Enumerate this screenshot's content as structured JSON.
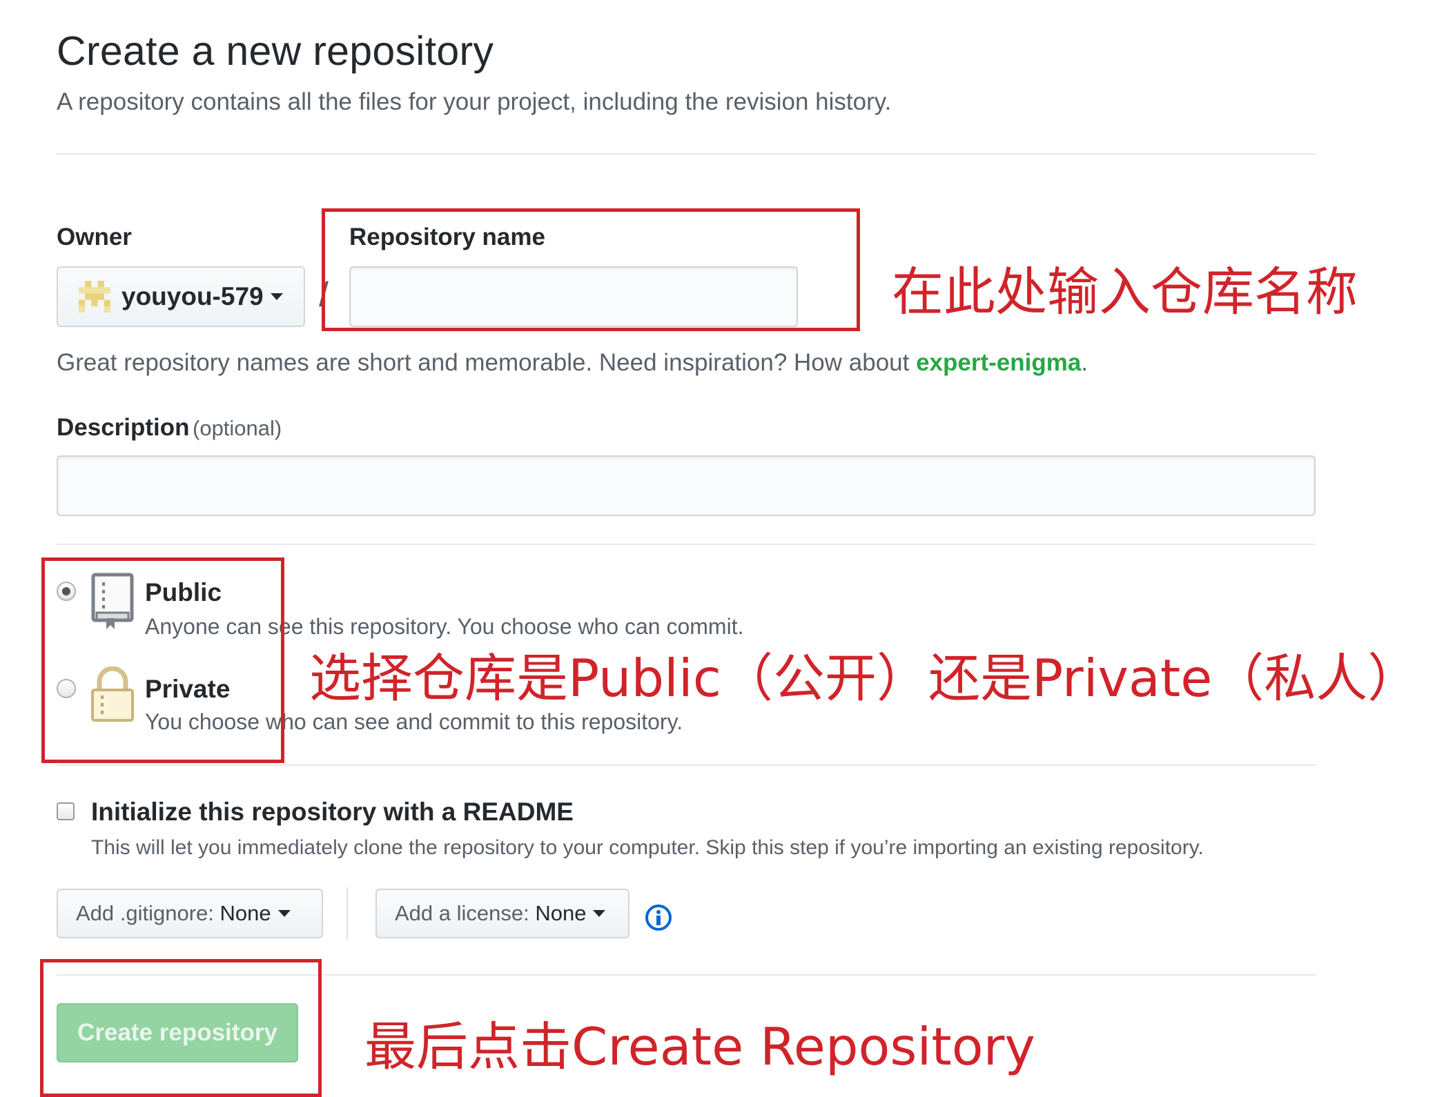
{
  "header": {
    "title": "Create a new repository",
    "subtitle": "A repository contains all the files for your project, including the revision history."
  },
  "owner": {
    "label": "Owner",
    "value": "youyou-579"
  },
  "slash": "/",
  "repo_name": {
    "label": "Repository name",
    "value": "",
    "placeholder": ""
  },
  "name_hint": {
    "text": "Great repository names are short and memorable. Need inspiration? How about ",
    "suggestion": "expert-enigma",
    "end": "."
  },
  "description": {
    "label": "Description",
    "optional": "(optional)",
    "value": ""
  },
  "visibility": {
    "selected": "public",
    "public": {
      "label": "Public",
      "note": "Anyone can see this repository. You choose who can commit."
    },
    "private": {
      "label": "Private",
      "note": "You choose who can see and commit to this repository."
    }
  },
  "readme": {
    "checked": false,
    "label": "Initialize this repository with a README",
    "note": "This will let you immediately clone the repository to your computer. Skip this step if you’re importing an existing repository."
  },
  "gitignore": {
    "prefix": "Add .gitignore:",
    "value": "None"
  },
  "license": {
    "prefix": "Add a license:",
    "value": "None"
  },
  "submit": {
    "label": "Create repository"
  },
  "annotations": {
    "name": "在此处输入仓库名称",
    "visibility": "选择仓库是Public（公开）还是Private（私人）",
    "submit": "最后点击Create Repository"
  },
  "colors": {
    "annotation": "#d0242a",
    "suggestion": "#28a745",
    "submit_disabled": "#94d3a2",
    "info_icon": "#0366d6"
  }
}
